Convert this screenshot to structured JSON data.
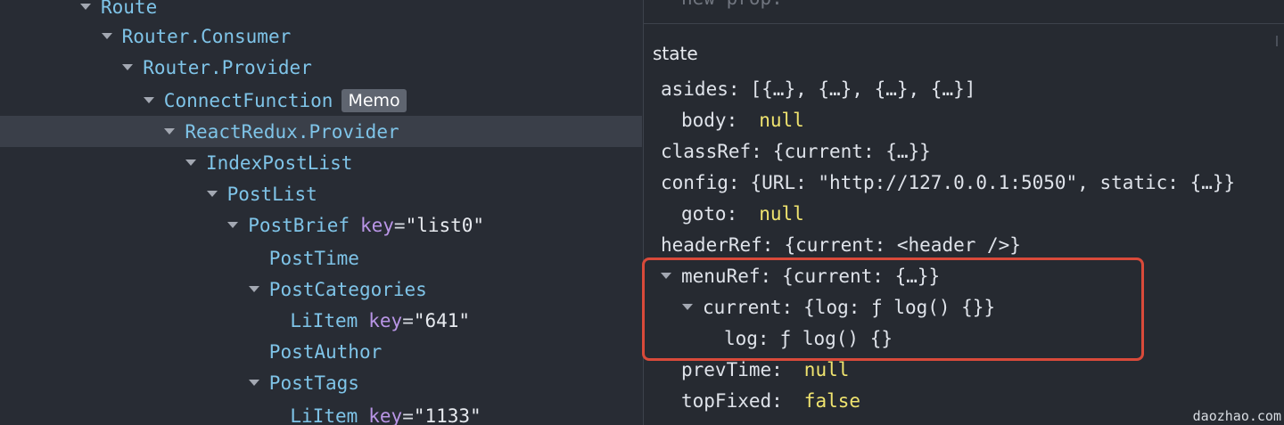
{
  "tree": [
    {
      "name": "Route",
      "depth": 0,
      "expanded": true
    },
    {
      "name": "Router.Consumer",
      "depth": 1,
      "expanded": true
    },
    {
      "name": "Router.Provider",
      "depth": 2,
      "expanded": true
    },
    {
      "name": "ConnectFunction",
      "depth": 3,
      "expanded": true,
      "badge": "Memo"
    },
    {
      "name": "ReactRedux.Provider",
      "depth": 4,
      "expanded": true,
      "selected": true
    },
    {
      "name": "IndexPostList",
      "depth": 5,
      "expanded": true
    },
    {
      "name": "PostList",
      "depth": 6,
      "expanded": true
    },
    {
      "name": "PostBrief",
      "depth": 7,
      "expanded": true,
      "key": "\"list0\""
    },
    {
      "name": "PostTime",
      "depth": 8,
      "expanded": false
    },
    {
      "name": "PostCategories",
      "depth": 8,
      "expanded": true
    },
    {
      "name": "LiItem",
      "depth": 9,
      "expanded": false,
      "key": "\"641\""
    },
    {
      "name": "PostAuthor",
      "depth": 8,
      "expanded": false
    },
    {
      "name": "PostTags",
      "depth": 8,
      "expanded": true
    },
    {
      "name": "LiItem",
      "depth": 9,
      "expanded": false,
      "key": "\"1133\""
    }
  ],
  "props": {
    "new_prop_placeholder": "new prop:"
  },
  "state": {
    "title": "state",
    "rows": [
      {
        "name": "asides",
        "value": "[{…}, {…}, {…}, {…}]",
        "type": "collapsed",
        "depth": 0
      },
      {
        "name": "body",
        "value": "null",
        "type": "null",
        "depth": 0
      },
      {
        "name": "classRef",
        "value": "{current: {…}}",
        "type": "collapsed",
        "depth": 0
      },
      {
        "name": "config",
        "value": "{URL: \"http://127.0.0.1:5050\", static: {…}}",
        "type": "collapsed",
        "depth": 0
      },
      {
        "name": "goto",
        "value": "null",
        "type": "null",
        "depth": 0
      },
      {
        "name": "headerRef",
        "value": "{current: <header />}",
        "type": "collapsed",
        "depth": 0
      },
      {
        "name": "menuRef",
        "value": "{current: {…}}",
        "type": "expanded",
        "depth": 0
      },
      {
        "name": "current",
        "value": "{log: ƒ log() {}}",
        "type": "expanded",
        "depth": 1
      },
      {
        "name": "log",
        "value": "ƒ log() {}",
        "type": "leaf",
        "depth": 2
      },
      {
        "name": "prevTime",
        "value": "null",
        "type": "null",
        "depth": 0
      },
      {
        "name": "topFixed",
        "value": "false",
        "type": "bool",
        "depth": 0
      }
    ]
  },
  "watermark": "daozhao.com",
  "colors": {
    "highlight_border": "#d94a3a",
    "component_name": "#7fc4e8",
    "prop_key": "#b995e6",
    "literal": "#f0e46f"
  }
}
